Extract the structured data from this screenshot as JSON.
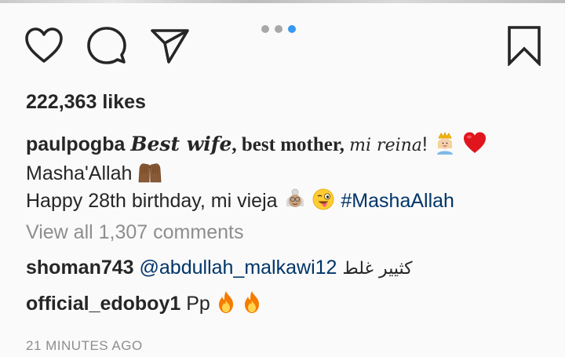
{
  "post": {
    "likes_text": "222,363 likes",
    "carousel": {
      "total": 3,
      "active_index": 2,
      "active_color": "#3897f0",
      "inactive_color": "#a8a8a8"
    },
    "actions": {
      "like_icon": "heart-icon",
      "comment_icon": "speech-bubble-icon",
      "share_icon": "paper-plane-icon",
      "save_icon": "bookmark-icon"
    },
    "caption": {
      "username": "paulpogba",
      "part1": "Best wife",
      "part2": ", best mother, ",
      "part3": "mi reina",
      "part4": "!",
      "line2": "Masha'Allah",
      "line3_text": "Happy 28th birthday, mi vieja",
      "hashtag": "#MashaAllah",
      "emojis": [
        "princess-emoji",
        "red-heart-emoji",
        "raised-hands-emoji",
        "older-woman-emoji",
        "winking-tongue-emoji"
      ]
    },
    "view_all_comments": "View all 1,307 comments",
    "comments": [
      {
        "username": "shoman743",
        "mention": "@abdullah_malkawi12",
        "text": "كثيير غلط"
      },
      {
        "username": "official_edoboy1",
        "text": "Pp",
        "emojis": [
          "fire-emoji",
          "fire-emoji"
        ]
      }
    ],
    "timestamp": "21 MINUTES AGO",
    "link_color": "#003569"
  }
}
